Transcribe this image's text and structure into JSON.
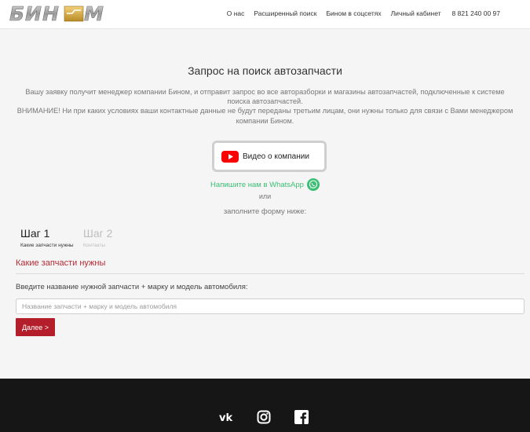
{
  "header": {
    "logo_text": "БИНОМ",
    "nav": [
      "О нас",
      "Расширенный поиск",
      "Бином в соцсетях",
      "Личный кабинет"
    ],
    "phone": "8 821 240 00 97"
  },
  "main": {
    "title": "Запрос на поиск автозапчасти",
    "intro_line1": "Вашу заявку получит менеджер компании Бином, и отправит запрос во все авторазборки и магазины автозапчастей, подключенные к системе поиска автозапчастей.",
    "intro_line2": "ВНИМАНИЕ! Ни при каких условиях ваши контактные данные не будут переданы третьим лицам, они нужны только для связи с Вами менеджером компании Бином.",
    "video_label": "Видео о компании",
    "whatsapp_label": "Напишите нам в WhatsApp",
    "or_text": "или",
    "fill_text": "заполните форму ниже:"
  },
  "steps": [
    {
      "title": "Шаг 1",
      "subtitle": "Какие запчасти нужны"
    },
    {
      "title": "Шаг 2",
      "subtitle": "Контакты"
    }
  ],
  "form": {
    "section_title": "Какие запчасти нужны",
    "label": "Введите название нужной запчасти + марку и модель автомобиля:",
    "input_value": "",
    "input_placeholder": "Название запчасти + марку и модель автомобиля",
    "next_label": "Далее >"
  },
  "footer": {
    "social_icons": [
      "vk-icon",
      "instagram-icon",
      "facebook-icon"
    ]
  },
  "colors": {
    "accent": "#b31e2a",
    "whatsapp": "#3bbf74",
    "footer_bg": "#161616"
  }
}
